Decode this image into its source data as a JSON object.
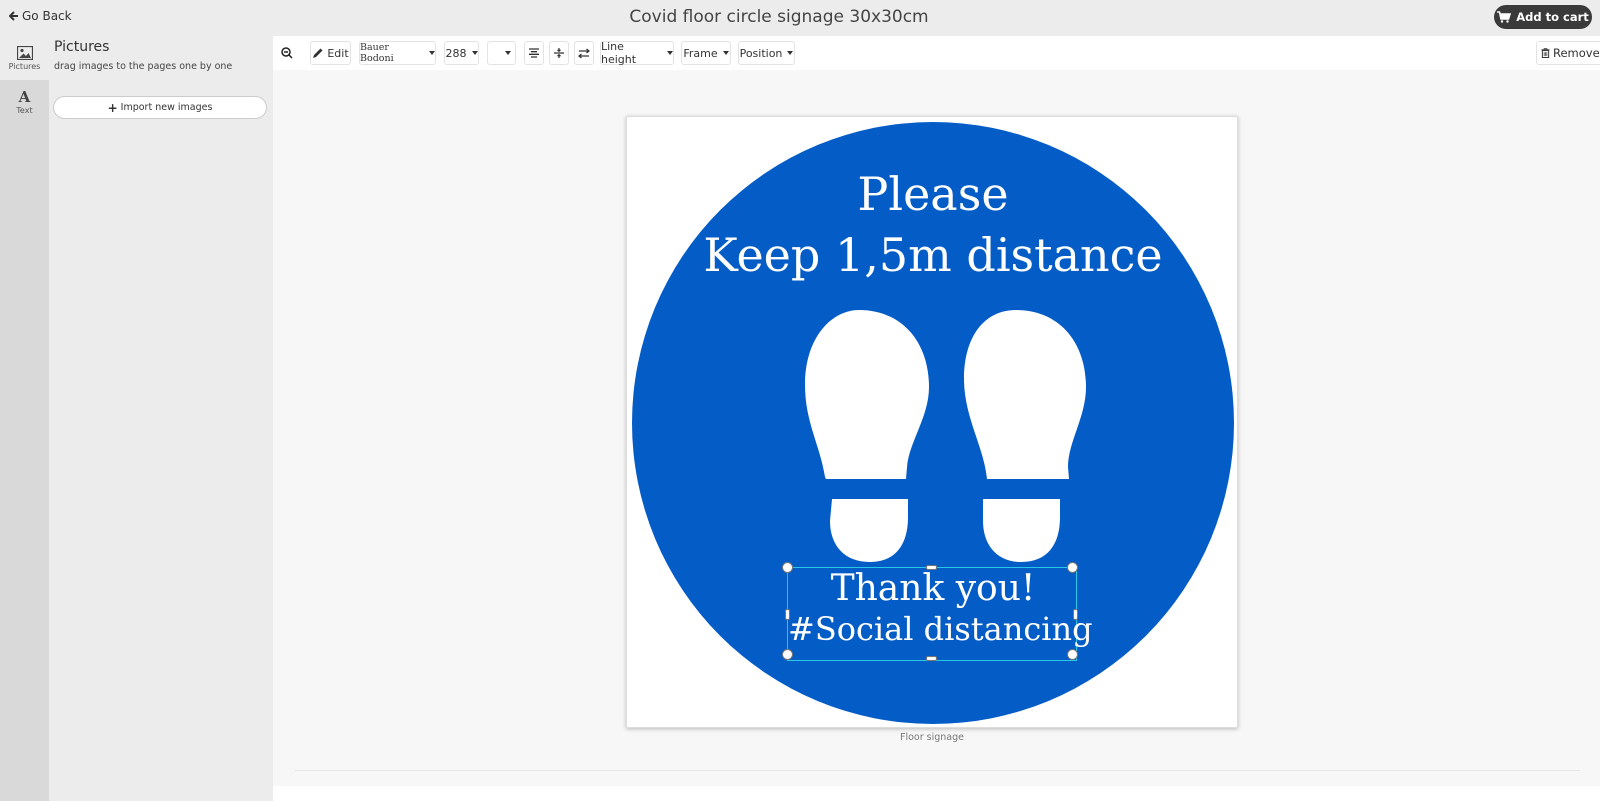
{
  "header": {
    "back_label": "Go Back",
    "title": "Covid floor circle signage 30x30cm",
    "cart_label": "Add to cart"
  },
  "rail": {
    "items": [
      {
        "label": "Pictures",
        "icon": "image-icon"
      },
      {
        "label": "Text",
        "icon": "text-icon",
        "glyph": "A"
      }
    ]
  },
  "panel": {
    "title": "Pictures",
    "subtitle": "drag images to the pages one by one",
    "import_label": "Import new images",
    "import_plus": "+"
  },
  "toolbar": {
    "edit_label": "Edit",
    "font_name": "Bauer Bodoni",
    "font_size": "288",
    "line_height_label": "Line height",
    "frame_label": "Frame",
    "position_label": "Position",
    "remove_label": "Remove"
  },
  "sign": {
    "line1": "Please",
    "line2": "Keep 1,5m distance",
    "selected_line1": "Thank you!",
    "selected_line2": "#Social distancing",
    "circle_color": "#045cc6",
    "text_color": "#ffffff",
    "selection_color": "#29c7e6"
  },
  "page_caption": "Floor signage"
}
